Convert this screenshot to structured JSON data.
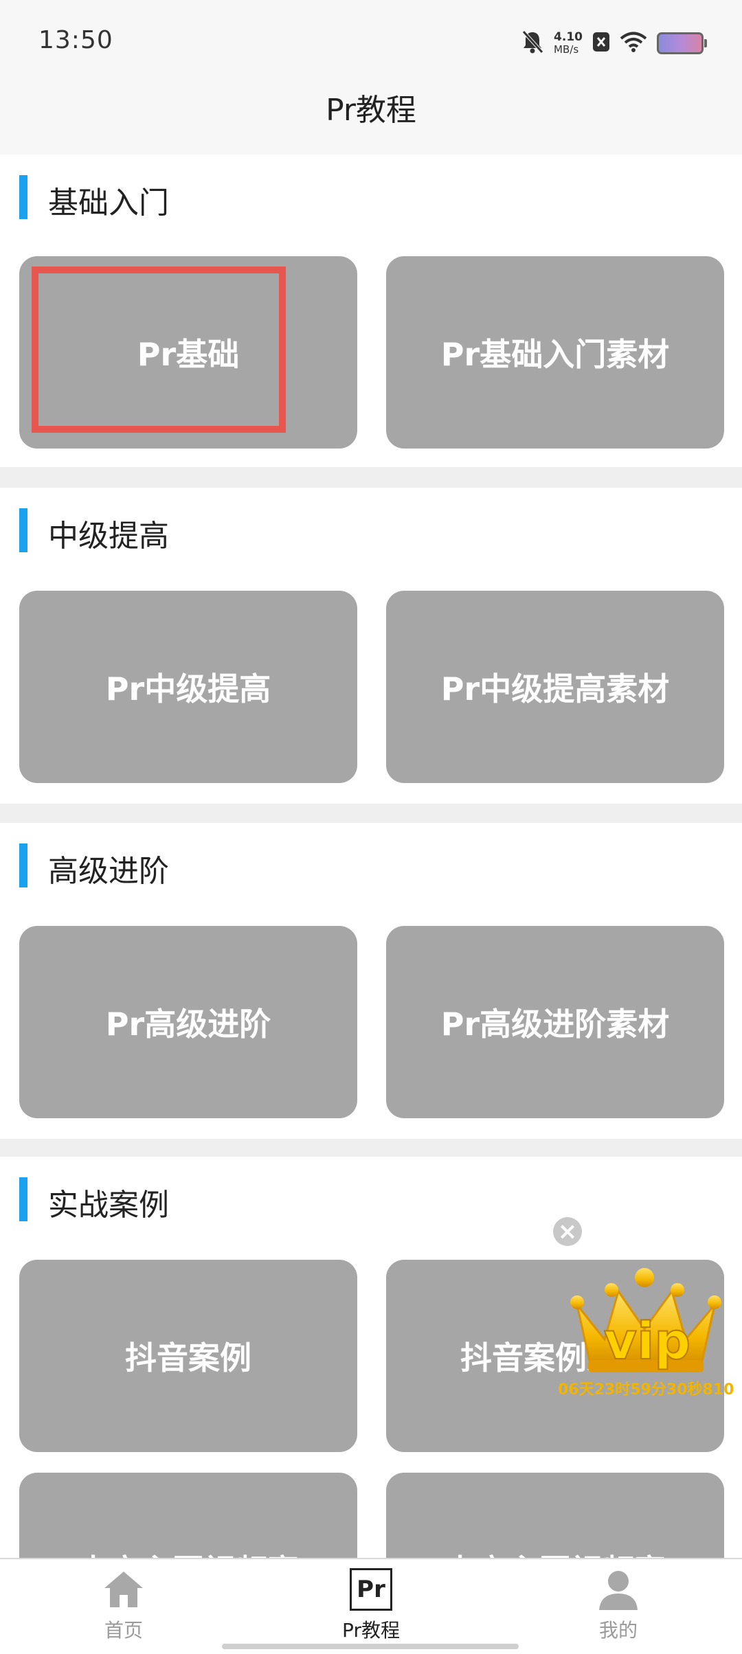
{
  "status_bar": {
    "time": "13:50",
    "speed_value": "4.10",
    "speed_unit": "MB/s"
  },
  "header": {
    "title": "Pr教程"
  },
  "sections": [
    {
      "title": "基础入门",
      "tiles": [
        "Pr基础",
        "Pr基础入门素材"
      ]
    },
    {
      "title": "中级提高",
      "tiles": [
        "Pr中级提高",
        "Pr中级提高素材"
      ]
    },
    {
      "title": "高级进阶",
      "tiles": [
        "Pr高级进阶",
        "Pr高级进阶素材"
      ]
    },
    {
      "title": "实战案例",
      "tiles": [
        "抖音案例",
        "抖音案例素材",
        "电商主图视频案",
        "电商主图视频案"
      ]
    }
  ],
  "vip_promo": {
    "label": "vip",
    "countdown": "06天23时59分30秒810",
    "close_symbol": "×"
  },
  "bottom_nav": {
    "items": [
      {
        "label": "首页",
        "icon": "home-icon",
        "active": false
      },
      {
        "label": "Pr教程",
        "icon": "pr-logo-icon",
        "active": true
      },
      {
        "label": "我的",
        "icon": "person-icon",
        "active": false
      }
    ]
  },
  "colors": {
    "accent_bar": "#1aa1f0",
    "tile_bg": "#a6a6a6",
    "highlight": "#e8574f",
    "vip_gold": "#f1b400"
  }
}
